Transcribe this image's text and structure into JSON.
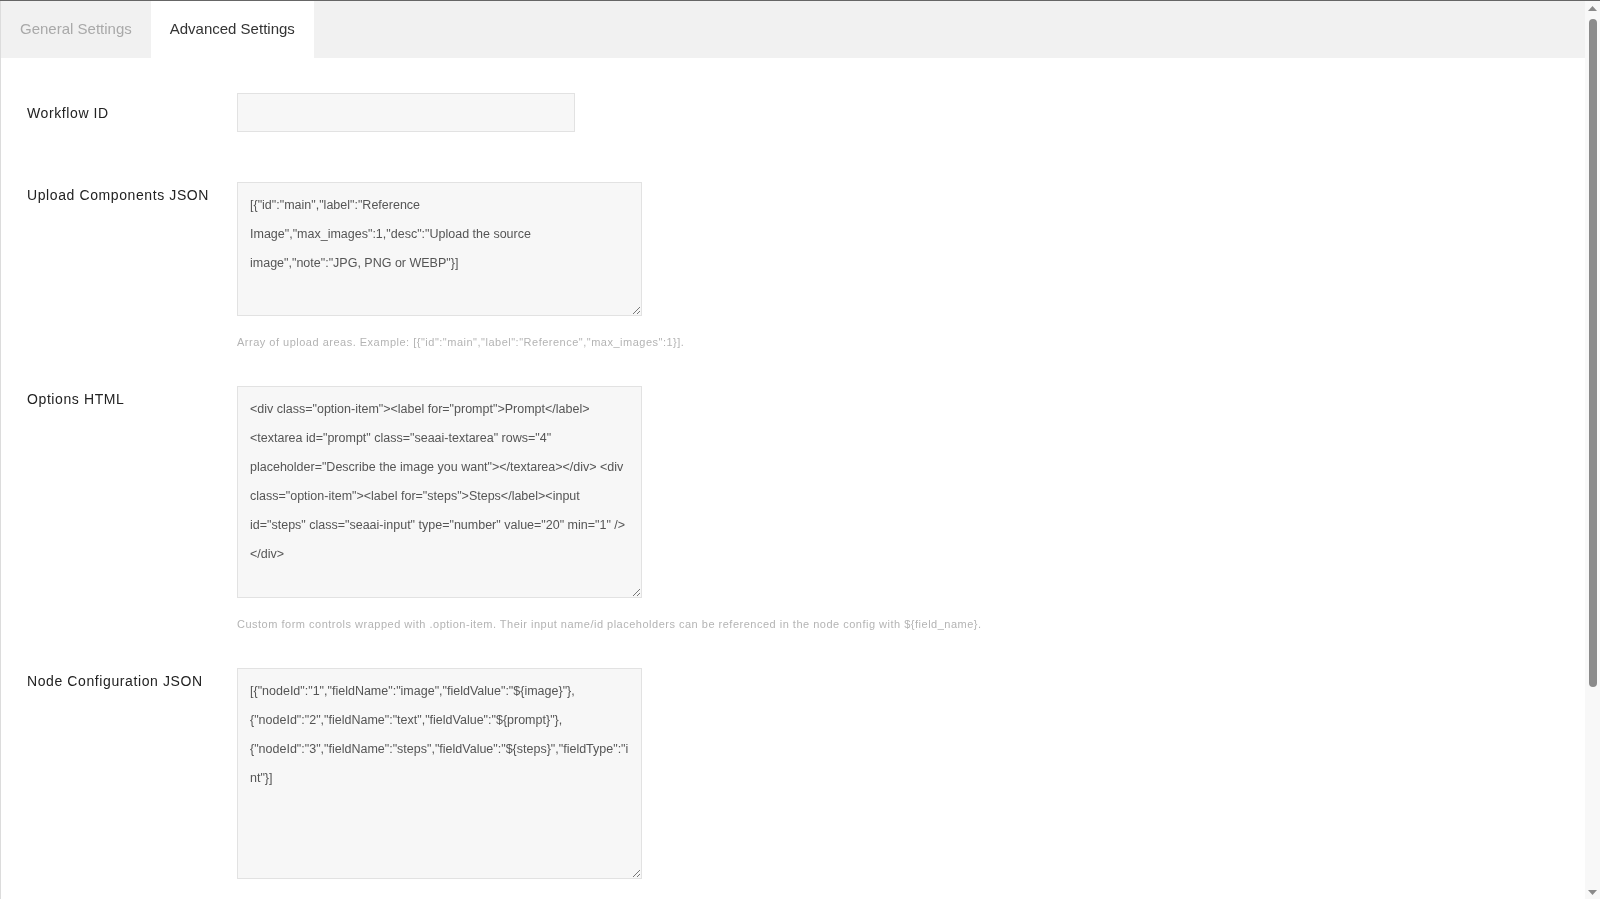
{
  "tabs": [
    {
      "label": "General Settings",
      "selected": false
    },
    {
      "label": "Advanced Settings",
      "selected": true
    }
  ],
  "fields": [
    {
      "kind": "input",
      "label": "Workflow ID"
    },
    {
      "kind": "textarea",
      "label": "Upload Components JSON",
      "value": "[{\"id\":\"main\",\"label\":\"Reference Image\",\"max_images\":1,\"desc\":\"Upload the source image\",\"note\":\"JPG, PNG or WEBP\"}]",
      "hint": "Array of upload areas. Example: [{\"id\":\"main\",\"label\":\"Reference\",\"max_images\":1}]."
    },
    {
      "kind": "textarea",
      "label": "Options HTML",
      "value": "<div class=\"option-item\"><label for=\"prompt\">Prompt</label> <textarea id=\"prompt\" class=\"seaai-textarea\" rows=\"4\" placeholder=\"Describe the image you want\"></textarea></div> <div class=\"option-item\"><label for=\"steps\">Steps</label><input id=\"steps\" class=\"seaai-input\" type=\"number\" value=\"20\" min=\"1\" /></div>",
      "hint": "Custom form controls wrapped with .option-item. Their input name/id placeholders can be referenced in the node config with ${field_name}."
    },
    {
      "kind": "textarea",
      "label": "Node Configuration JSON",
      "value": "[{\"nodeId\":\"1\",\"fieldName\":\"image\",\"fieldValue\":\"${image}\"},{\"nodeId\":\"2\",\"fieldName\":\"text\",\"fieldValue\":\"${prompt}\"},{\"nodeId\":\"3\",\"fieldName\":\"steps\",\"fieldValue\":\"${steps}\",\"fieldType\":\"int\"}]"
    }
  ]
}
